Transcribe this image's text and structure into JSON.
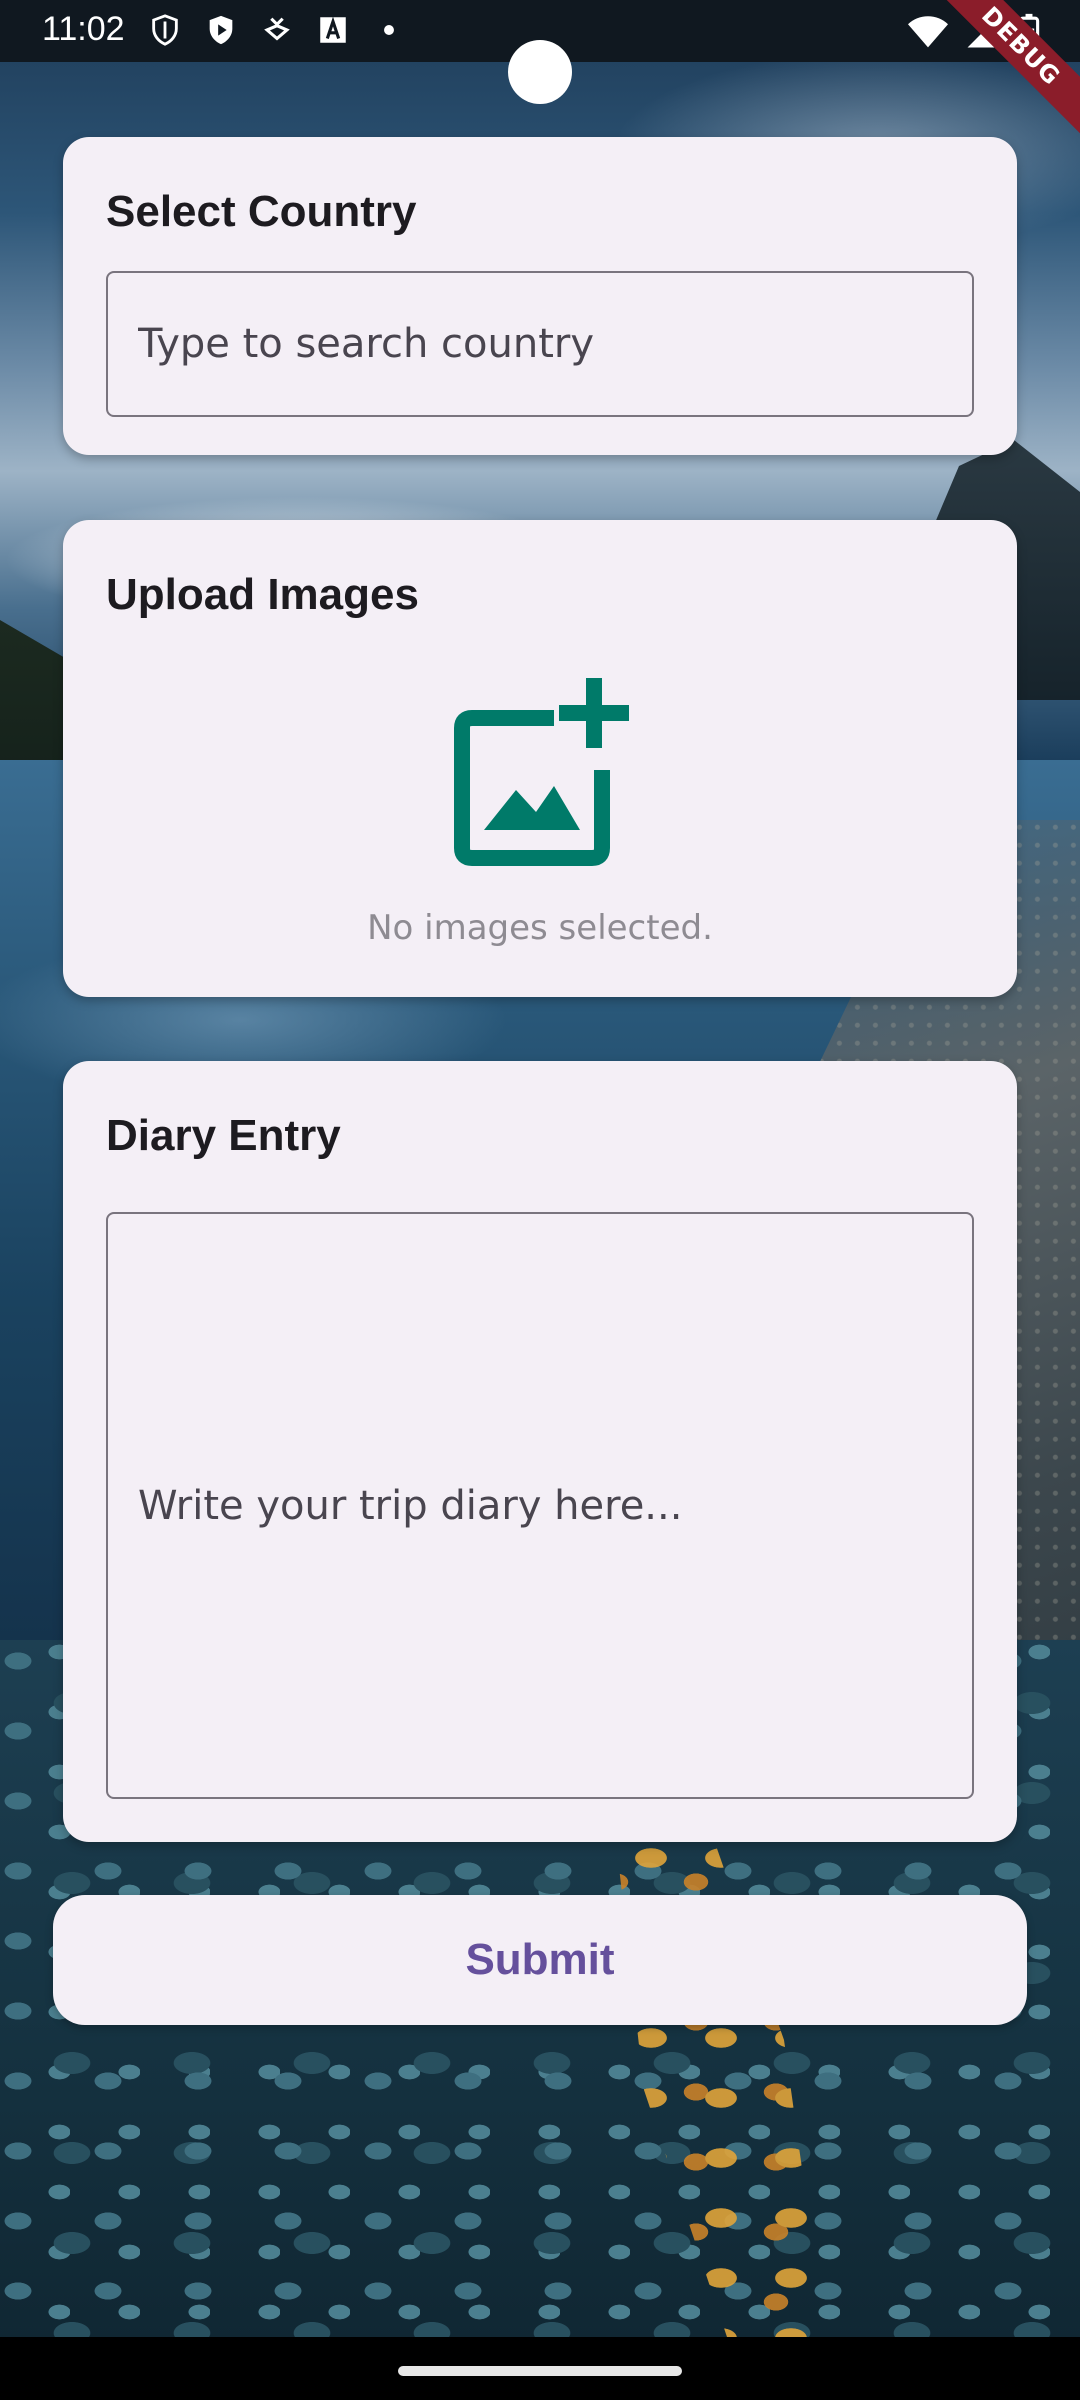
{
  "status_bar": {
    "time": "11:02",
    "debug_label": "DEBUG"
  },
  "select_country": {
    "title": "Select Country",
    "placeholder": "Type to search country",
    "value": ""
  },
  "upload_images": {
    "title": "Upload Images",
    "icon": "add-photo-icon",
    "empty_text": "No images selected."
  },
  "diary_entry": {
    "title": "Diary Entry",
    "placeholder": "Write your trip diary here...",
    "value": ""
  },
  "submit": {
    "label": "Submit"
  },
  "colors": {
    "card_background": "#f4eff6",
    "icon_accent": "#007a69",
    "button_text": "#65509c",
    "border": "#79747e"
  }
}
